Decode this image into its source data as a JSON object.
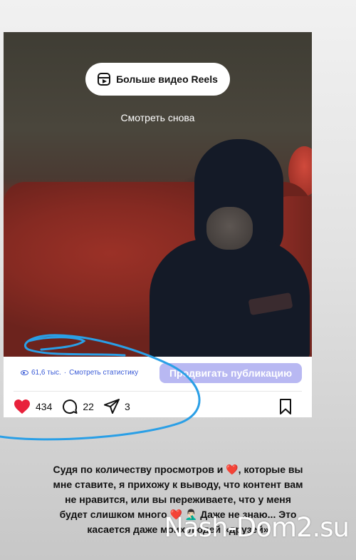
{
  "reels_button": {
    "label": "Больше видео Reels",
    "icon": "reels-icon"
  },
  "watch_again": "Смотреть снова",
  "stats": {
    "views": "61,6 тыс.",
    "separator": "·",
    "view_stats_link": "Смотреть статистику"
  },
  "promote_button": "Продвигать публикацию",
  "actions": {
    "likes": "434",
    "comments": "22",
    "shares": "3"
  },
  "colors": {
    "like": "#e8213b",
    "promote_bg": "#b8b8f2",
    "link": "#3a5bd6",
    "scribble": "#2a9fe6"
  },
  "caption": {
    "line1": "Судя по количеству просмотров и ❤️, которые вы",
    "line2": "мне ставите, я прихожу к выводу, что контент вам",
    "line3": "не нравится, или вы переживаете, что у меня",
    "line4": "будет слишком много ❤️ 🤦🏻‍♂️ Даже не знаю... Это",
    "line5": "касается даже моих людей «друзей»"
  },
  "watermark": "Nash-Dom2.su"
}
